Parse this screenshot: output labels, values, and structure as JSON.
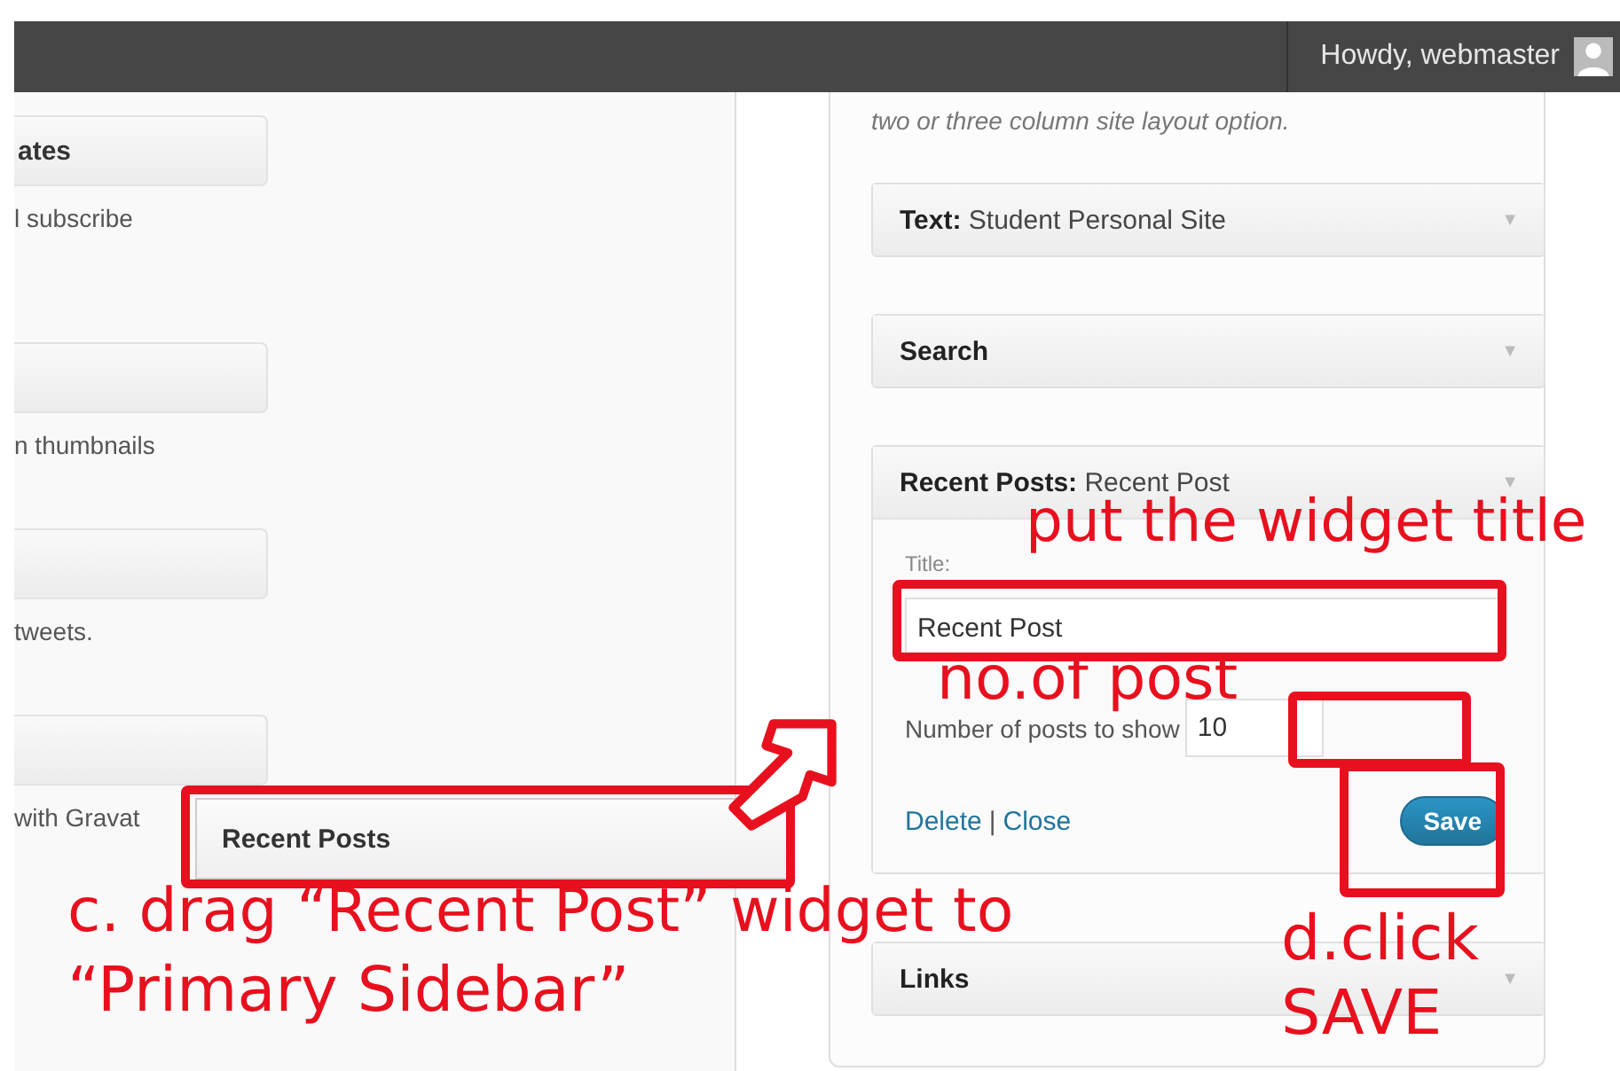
{
  "admin_bar": {
    "greeting": "Howdy, webmaster"
  },
  "available_widgets": [
    {
      "title": "ates",
      "description": "l subscribe"
    },
    {
      "description": "n thumbnails"
    },
    {
      "description": "tweets."
    },
    {
      "description": "with Gravat"
    }
  ],
  "dragged_widget": {
    "title": "Recent Posts"
  },
  "sidebar": {
    "description": "two or three column site layout option.",
    "widgets": [
      {
        "label": "Text:",
        "title": "Student Personal Site",
        "toggle": "▼"
      },
      {
        "label": "Search",
        "toggle": "▼"
      },
      {
        "label": "Recent Posts:",
        "title": "Recent Post",
        "toggle": "▼",
        "form": {
          "title_label": "Title:",
          "title_value": "Recent Post",
          "count_label": "Number of posts to show",
          "count_value": "10",
          "delete_link": "Delete",
          "separator": "|",
          "close_link": "Close",
          "save_button": "Save"
        }
      },
      {
        "label": "Links",
        "toggle": "▼"
      }
    ]
  },
  "annotations": [
    {
      "text": "put the widget title"
    },
    {
      "text": "no.of post"
    },
    {
      "text": "c. drag “Recent Post” widget to"
    },
    {
      "text": "“Primary Sidebar”"
    },
    {
      "text": "d.click"
    },
    {
      "text": "SAVE"
    }
  ]
}
